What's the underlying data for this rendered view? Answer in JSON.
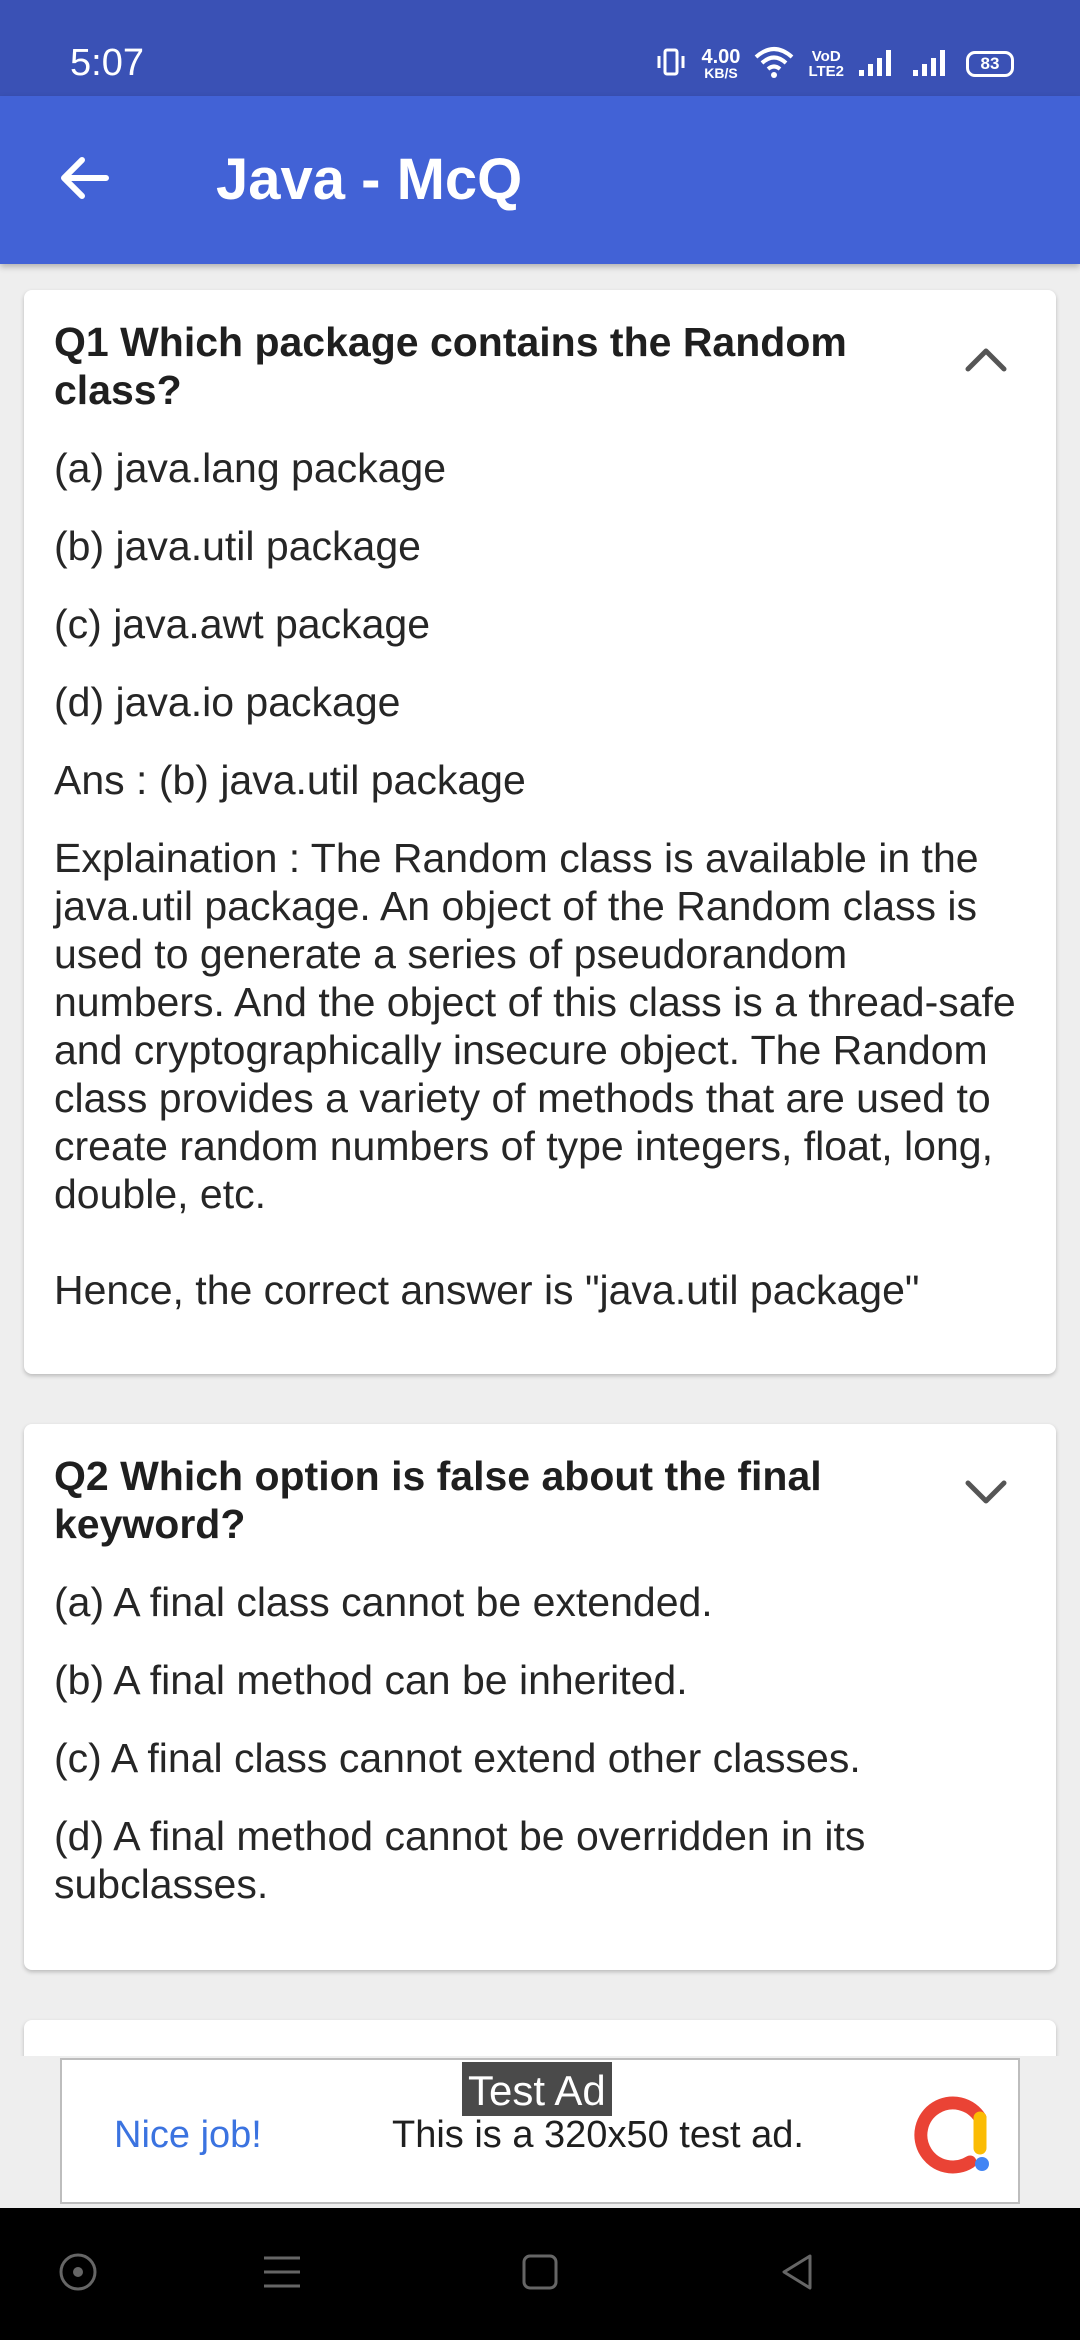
{
  "status_bar": {
    "time": "5:07",
    "net_speed_value": "4.00",
    "net_speed_unit": "KB/S",
    "volte_top": "VoD",
    "volte_bottom": "LTE2",
    "battery": "83"
  },
  "app_bar": {
    "title": "Java - McQ",
    "back_icon": "arrow-left-icon"
  },
  "questions": [
    {
      "title": "Q1  Which package contains the Random class?",
      "expanded": true,
      "options": [
        "(a) java.lang package",
        "(b) java.util package",
        "(c) java.awt package",
        "(d) java.io package"
      ],
      "answer": "Ans : (b) java.util package",
      "explanation": "Explaination : The Random class is available in the java.util package. An object of the Random class is used to generate a series of pseudorandom numbers. And the object of this class is a thread-safe and cryptographically insecure object. The Random class provides a variety of methods that are used to create random numbers of type integers, float, long, double, etc.",
      "conclusion": "Hence, the correct answer is \"java.util package\""
    },
    {
      "title": "Q2  Which option is false about the final keyword?",
      "expanded": false,
      "options": [
        "(a) A final class cannot be extended.",
        "(b) A final method can be inherited.",
        "(c) A final class cannot extend other classes.",
        "(d) A final method cannot be overridden in its subclasses."
      ]
    }
  ],
  "ad": {
    "badge": "Test Ad",
    "headline": "Nice job!",
    "text": "This is a 320x50 test ad."
  },
  "colors": {
    "status_bar": "#3a51b5",
    "app_bar": "#4262d6",
    "ad_link": "#3b73e0"
  }
}
